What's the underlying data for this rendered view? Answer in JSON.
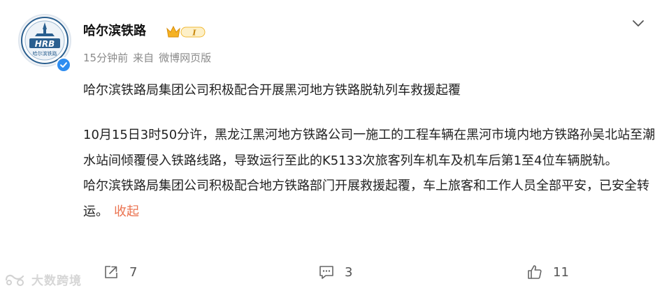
{
  "account": {
    "name": "哈尔滨铁路",
    "avatar_logo_text": "HRB",
    "avatar_sub_text": "哈尔滨铁路",
    "verified_icon": "verified-check-icon",
    "level_badge": "I"
  },
  "meta": {
    "time": "15分钟前",
    "source_prefix": "来自",
    "source": "微博网页版"
  },
  "post": {
    "title": "哈尔滨铁路局集团公司积极配合开展黑河地方铁路脱轨列车救援起覆",
    "paragraph1": "10月15日3时50分许，黑龙江黑河地方铁路公司一施工的工程车辆在黑河市境内地方铁路孙吴北站至潮水站间倾覆侵入铁路线路，导致运行至此的K5133次旅客列车机车及机车后第1至4位车辆脱轨。",
    "paragraph2": "哈尔滨铁路局集团公司积极配合地方铁路部门开展救援起覆，车上旅客和工作人员全部平安，已安全转运。",
    "collapse_label": "收起"
  },
  "actions": {
    "share_count": "7",
    "comment_count": "3",
    "like_count": "11"
  },
  "watermark": {
    "text": "大数跨境"
  },
  "colors": {
    "link": "#eb7350",
    "meta": "#8a8a8a",
    "verified": "#2f8df0",
    "badge": "#f6b93b"
  }
}
